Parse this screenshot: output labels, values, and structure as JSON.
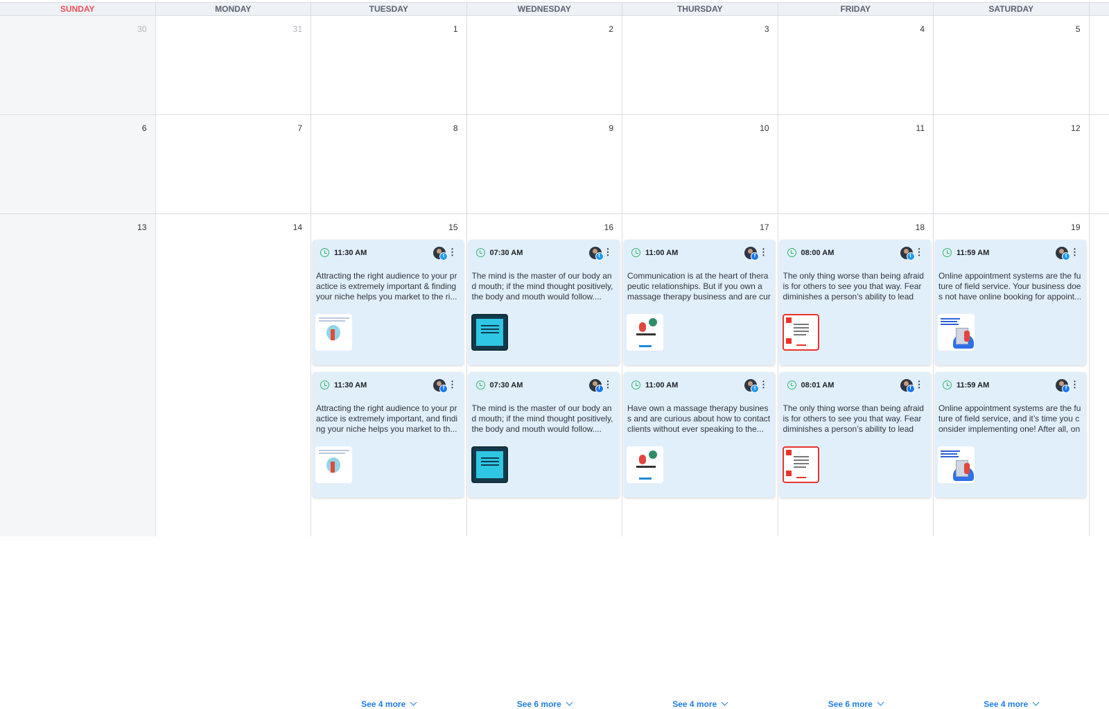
{
  "days_header": [
    "SUNDAY",
    "MONDAY",
    "TUESDAY",
    "WEDNESDAY",
    "THURSDAY",
    "FRIDAY",
    "SATURDAY"
  ],
  "colors": {
    "sunday_header": "#f0505a",
    "card_bg": "#e1effb",
    "link": "#1f7fe0",
    "clock": "#2fb86a"
  },
  "weeks": [
    {
      "days": [
        {
          "num": "30",
          "muted": true
        },
        {
          "num": "31",
          "muted": true
        },
        {
          "num": "1"
        },
        {
          "num": "2"
        },
        {
          "num": "3"
        },
        {
          "num": "4"
        },
        {
          "num": "5"
        }
      ]
    },
    {
      "days": [
        {
          "num": "6"
        },
        {
          "num": "7"
        },
        {
          "num": "8"
        },
        {
          "num": "9"
        },
        {
          "num": "10"
        },
        {
          "num": "11"
        },
        {
          "num": "12"
        }
      ]
    },
    {
      "days": [
        {
          "num": "13"
        },
        {
          "num": "14"
        },
        {
          "num": "15"
        },
        {
          "num": "16"
        },
        {
          "num": "17"
        },
        {
          "num": "18"
        },
        {
          "num": "19"
        }
      ]
    }
  ],
  "posts": {
    "tue": [
      {
        "time": "11:30 AM",
        "network": "twitter",
        "network_icon": "twitter-icon",
        "thumb": "audience",
        "text": "Attracting the right audience to your practice is extremely important & finding your niche helps you market to the ri..."
      },
      {
        "time": "11:30 AM",
        "network": "facebook",
        "network_icon": "facebook-icon",
        "thumb": "audience",
        "text": "Attracting the right audience to your practice is extremely important, and finding your niche helps you market to th..."
      }
    ],
    "wed": [
      {
        "time": "07:30 AM",
        "network": "twitter",
        "network_icon": "twitter-icon",
        "thumb": "mind",
        "text": "The mind is the master of our body and mouth; if the mind thought positively, the body and mouth would follow...."
      },
      {
        "time": "07:30 AM",
        "network": "facebook",
        "network_icon": "facebook-icon",
        "thumb": "mind",
        "text": "The mind is the master of our body and mouth; if the mind thought positively, the body and mouth would follow...."
      }
    ],
    "thu": [
      {
        "time": "11:00 AM",
        "network": "facebook",
        "network_icon": "facebook-icon",
        "thumb": "communication",
        "text": "Communication is at the heart of therapeutic relationships. But if you own a massage therapy business and are curi..."
      },
      {
        "time": "11:00 AM",
        "network": "twitter",
        "network_icon": "twitter-icon",
        "thumb": "communication",
        "text": "Have own a massage therapy business and are curious about how to contact clients without ever speaking to the..."
      }
    ],
    "fri": [
      {
        "time": "08:00 AM",
        "network": "twitter",
        "network_icon": "twitter-icon",
        "thumb": "fear",
        "text": "The only thing worse than being afraid is for others to see you that way. Fear diminishes a person’s ability to lead o..."
      },
      {
        "time": "08:01 AM",
        "network": "facebook",
        "network_icon": "facebook-icon",
        "thumb": "fear",
        "text": "The only thing worse than being afraid is for others to see you that way. Fear diminishes a person’s ability to lead o..."
      }
    ],
    "sat": [
      {
        "time": "11:59 AM",
        "network": "twitter",
        "network_icon": "twitter-icon",
        "thumb": "appointment",
        "text": "Online appointment systems are the future of field service. Your business does not have online booking for appoint..."
      },
      {
        "time": "11:59 AM",
        "network": "facebook",
        "network_icon": "facebook-icon",
        "thumb": "appointment",
        "text": "Online appointment systems are the future of field service, and it’s time you consider implementing one! After all, onl..."
      }
    ]
  },
  "see_more": {
    "tue": "See 4 more",
    "wed": "See 6 more",
    "thu": "See 4 more",
    "fri": "See 6 more",
    "sat": "See 4 more"
  }
}
